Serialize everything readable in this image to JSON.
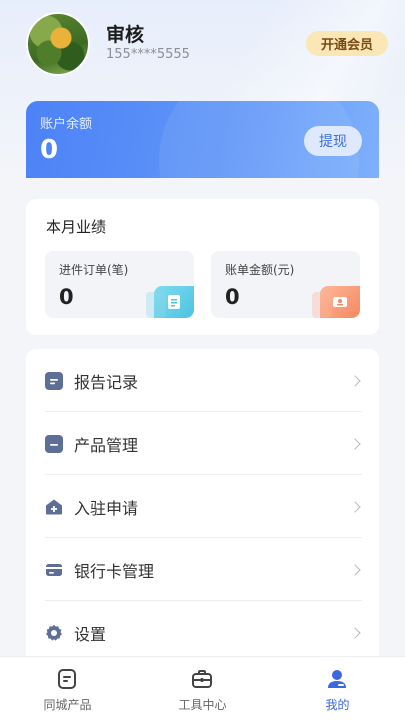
{
  "profile": {
    "name": "审核",
    "phone": "155****5555",
    "vip_label": "开通会员"
  },
  "balance": {
    "label": "账户余额",
    "value": "0",
    "withdraw_label": "提现"
  },
  "performance": {
    "title": "本月业绩",
    "orders": {
      "label": "进件订单(笔)",
      "value": "0"
    },
    "amount": {
      "label": "账单金额(元)",
      "value": "0"
    }
  },
  "menu": {
    "items": [
      {
        "label": "报告记录",
        "icon": "report-icon"
      },
      {
        "label": "产品管理",
        "icon": "folder-icon"
      },
      {
        "label": "入驻申请",
        "icon": "home-plus-icon"
      },
      {
        "label": "银行卡管理",
        "icon": "bank-card-icon"
      },
      {
        "label": "设置",
        "icon": "gear-icon"
      }
    ]
  },
  "tabbar": {
    "tabs": [
      {
        "label": "同城产品",
        "icon": "document-icon"
      },
      {
        "label": "工具中心",
        "icon": "toolbox-icon"
      },
      {
        "label": "我的",
        "icon": "user-icon"
      }
    ],
    "active_index": 2
  },
  "colors": {
    "accent": "#4c82f6",
    "active_tab": "#3b68e0",
    "vip_bg": "#fbe6b6",
    "menu_icon": "#5e6f97"
  }
}
